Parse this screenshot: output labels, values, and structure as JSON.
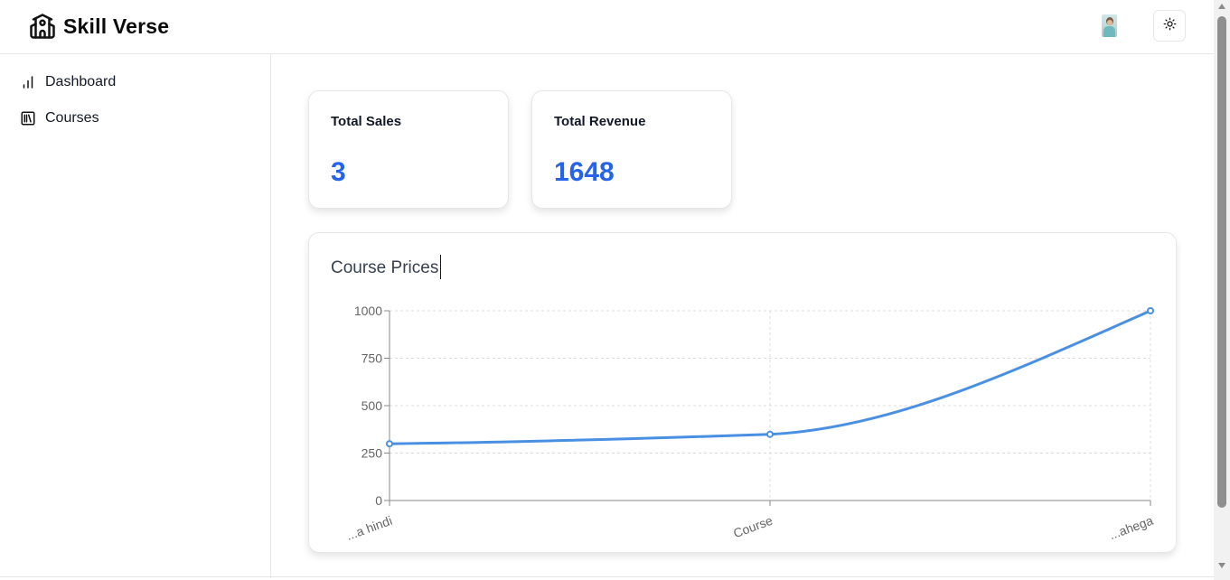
{
  "header": {
    "brand_icon": "school-icon",
    "brand_title": "Skill Verse",
    "avatar_icon": "user-avatar",
    "theme_icon": "sun-icon"
  },
  "sidebar": {
    "items": [
      {
        "label": "Dashboard",
        "icon": "bar-chart-icon"
      },
      {
        "label": "Courses",
        "icon": "library-icon"
      }
    ]
  },
  "stats": {
    "sales": {
      "title": "Total Sales",
      "value": "3"
    },
    "revenue": {
      "title": "Total Revenue",
      "value": "1648"
    }
  },
  "chart_card": {
    "title": "Course Prices"
  },
  "colors": {
    "accent": "#2563eb",
    "line": "#4a90e2"
  },
  "chart_data": {
    "type": "line",
    "categories": [
      "...a hindi",
      "Course",
      "...ahega"
    ],
    "values": [
      299,
      349,
      1000
    ],
    "ylim": [
      0,
      1000
    ],
    "yticks": [
      0,
      250,
      500,
      750,
      1000
    ],
    "grid": true,
    "xlabel": "",
    "ylabel": ""
  }
}
